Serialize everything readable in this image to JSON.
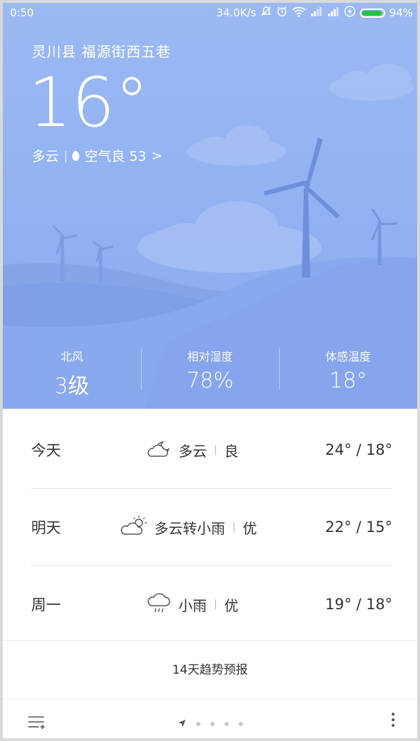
{
  "status_bar": {
    "time": "0:50",
    "speed": "34.0K/s",
    "battery_percent": "94%",
    "battery_fraction": 0.94,
    "icons": [
      "mute-icon",
      "alarm-icon",
      "wifi-icon",
      "signal-icon",
      "signal-icon",
      "charging-icon",
      "battery-icon"
    ]
  },
  "location": "灵川县  福源街西五巷",
  "current": {
    "temperature": "16°",
    "condition": "多云",
    "separator": "|",
    "aqi_label": "空气良 53",
    "aqi_arrow": ">"
  },
  "stats": [
    {
      "label": "北风",
      "value": "3级"
    },
    {
      "label": "相对湿度",
      "value": "78%"
    },
    {
      "label": "体感温度",
      "value": "18°"
    }
  ],
  "forecast": [
    {
      "day": "今天",
      "icon": "cloudy-night-icon",
      "condition": "多云",
      "quality": "良",
      "range": "24° / 18°"
    },
    {
      "day": "明天",
      "icon": "partly-cloudy-icon",
      "condition": "多云转小雨",
      "quality": "优",
      "range": "22° / 15°"
    },
    {
      "day": "周一",
      "icon": "rain-icon",
      "condition": "小雨",
      "quality": "优",
      "range": "19° / 18°"
    }
  ],
  "trend_label": "14天趋势预报",
  "bottom_bar": {
    "pages": 5,
    "current_page": 1,
    "menu_icon": "city-list-icon",
    "more_icon": "more-icon"
  },
  "colors": {
    "sky": "#93b2f2",
    "battery": "#27c24c"
  }
}
